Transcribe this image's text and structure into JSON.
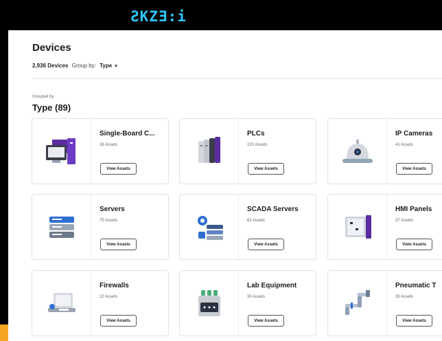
{
  "brand": {
    "logo_text": "ƧKZƎ:i"
  },
  "colors": {
    "accent_purple": "#5a2ca0",
    "accent_blue": "#2f6fd1",
    "edge_orange": "#f5a623",
    "logo_cyan": "#2fc6ff"
  },
  "header": {
    "title": "Devices",
    "device_count": "2,936 Devices",
    "group_by_label": "Group by:",
    "group_by_value": "Type",
    "group_by_chevron": "▾"
  },
  "group": {
    "caption": "Grouped by",
    "title": "Type (89)"
  },
  "cards": [
    {
      "title": "Single-Board C...",
      "count": "26 Assets",
      "button": "View Assets",
      "icon": "single-board-computer-icon"
    },
    {
      "title": "PLCs",
      "count": "220 Assets",
      "button": "View Assets",
      "icon": "plc-icon"
    },
    {
      "title": "IP Cameras",
      "count": "41 Assets",
      "button": "View Assets",
      "icon": "ip-camera-icon"
    },
    {
      "title": "Servers",
      "count": "75 Assets",
      "button": "View Assets",
      "icon": "server-icon"
    },
    {
      "title": "SCADA Servers",
      "count": "61 Assets",
      "button": "View Assets",
      "icon": "scada-server-icon"
    },
    {
      "title": "HMI Panels",
      "count": "37 Assets",
      "button": "View Assets",
      "icon": "hmi-panel-icon"
    },
    {
      "title": "Firewalls",
      "count": "22 Assets",
      "button": "View Assets",
      "icon": "firewall-icon"
    },
    {
      "title": "Lab Equipment",
      "count": "30 Assets",
      "button": "View Assets",
      "icon": "lab-equipment-icon"
    },
    {
      "title": "Pneumatic T",
      "count": "35 Assets",
      "button": "View Assets",
      "icon": "pneumatic-icon"
    }
  ]
}
